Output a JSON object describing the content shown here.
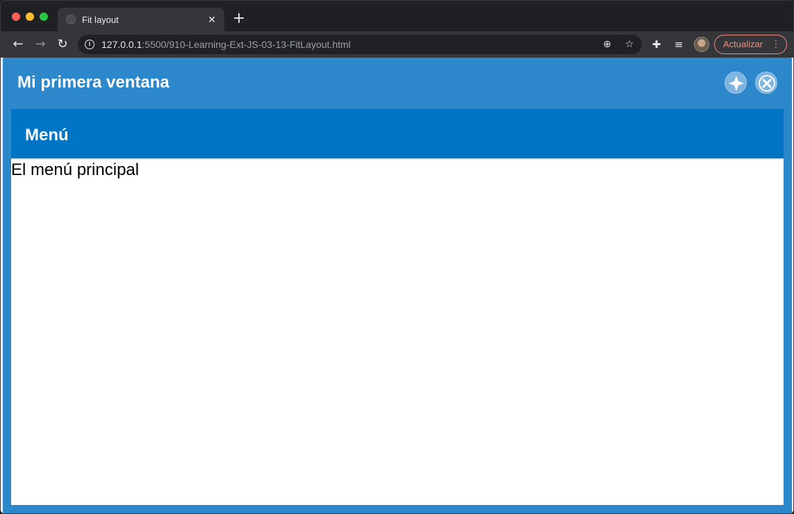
{
  "browser": {
    "tab": {
      "title": "Fit layout",
      "close_glyph": "✕"
    },
    "new_tab_glyph": "+",
    "nav": {
      "back_glyph": "←",
      "forward_glyph": "→",
      "reload_glyph": "↻"
    },
    "address": {
      "host": "127.0.0.1",
      "path": ":5500/910-Learning-Ext-JS-03-13-FitLayout.html"
    },
    "icons": {
      "info": "info-icon",
      "zoom": "zoom-icon",
      "star": "star-icon",
      "extensions": "puzzle-icon",
      "media": "media-control-icon",
      "avatar": "profile-avatar"
    },
    "zoom_glyph": "⊕",
    "star_glyph": "☆",
    "ext_glyph": "✚",
    "media_glyph": "≡",
    "update_button": {
      "label": "Actualizar",
      "menu_glyph": "⋮"
    }
  },
  "window": {
    "title": "Mi primera ventana",
    "tools": [
      "maximize-icon",
      "close-icon"
    ],
    "panel": {
      "title": "Menú",
      "body": "El menú principal"
    }
  },
  "colors": {
    "window_header": "#2c87cb",
    "panel_header": "#0074c5",
    "update_accent": "#f28b82"
  }
}
